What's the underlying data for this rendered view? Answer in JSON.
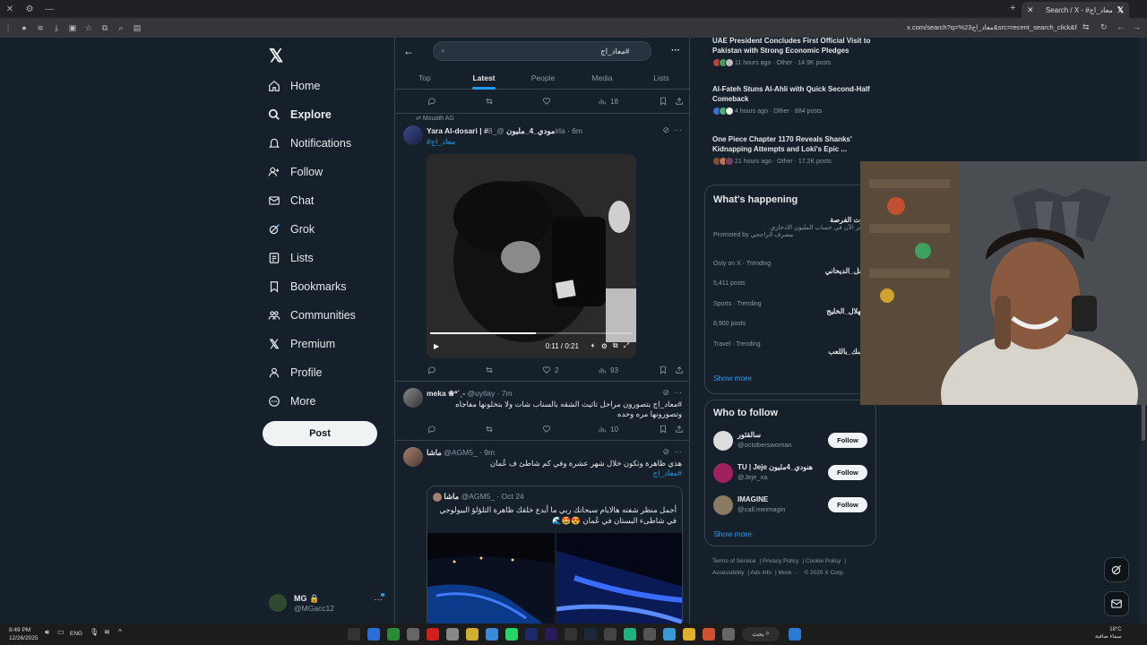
{
  "browser": {
    "tab_title": "Search / X - #معاد_اج",
    "url": "x.com/search?q=%23معاد_اج&src=recent_search_click&f=live"
  },
  "nav": {
    "items": [
      {
        "label": "Home",
        "icon": "home-icon"
      },
      {
        "label": "Explore",
        "icon": "search-icon"
      },
      {
        "label": "Notifications",
        "icon": "bell-icon"
      },
      {
        "label": "Follow",
        "icon": "follow-icon"
      },
      {
        "label": "Chat",
        "icon": "mail-icon"
      },
      {
        "label": "Grok",
        "icon": "grok-icon"
      },
      {
        "label": "Lists",
        "icon": "lists-icon"
      },
      {
        "label": "Bookmarks",
        "icon": "bookmark-icon"
      },
      {
        "label": "Communities",
        "icon": "communities-icon"
      },
      {
        "label": "Premium",
        "icon": "x-logo-icon"
      },
      {
        "label": "Profile",
        "icon": "profile-icon"
      },
      {
        "label": "More",
        "icon": "more-icon"
      }
    ],
    "post_label": "Post"
  },
  "account": {
    "name": "MG 🔒",
    "handle": "@MGacc12"
  },
  "search": {
    "value": "#معاد_اج"
  },
  "tabs": [
    "Top",
    "Latest",
    "People",
    "Media",
    "Lists"
  ],
  "tweets": {
    "first_actions": {
      "views": "18"
    },
    "t1": {
      "repost_label": "Mouath AG",
      "name": "Yara Al-dosari | #مودي_4_مليون",
      "handle": "@_8irla · 6m",
      "text": "#معاد_اج",
      "video_time": "0:11 / 0:21",
      "video_progress": 0.52,
      "likes": "2",
      "views": "93"
    },
    "t2": {
      "name": "meka ❀*ˊˎ-",
      "handle": "@uytlay · 7m",
      "text": "#معاد_اج بتصورون مراحل تاثيث الشقه بالسناب شات ولا بتخلونها مفاجاه وتصورونها مره وحده",
      "views": "10"
    },
    "t3": {
      "name": "ماشا",
      "handle": "@AGM5_ · 9m",
      "text": "هذي ظاهرة وتكون خلال شهر عشرة وفي كم شاطئ ف عُمان",
      "hashtag": "#معاد_اج",
      "quote": {
        "name": "ماشا",
        "handle": "@AGM5_ · Oct 24",
        "text": "أجمل منظر شفته هالايام سبحانك ربي ما أبدع خلقك ظاهرة التلؤلؤ البيولوجي في شاطىء البستان في عُمان 😍🤩🌊"
      }
    }
  },
  "news": [
    {
      "title": "UAE President Concludes First Official Visit to Pakistan with Strong Economic Pledges",
      "meta": "11 hours ago · Other · 14.9K posts"
    },
    {
      "title": "Al-Fateh Stuns Al-Ahli with Quick Second-Half Comeback",
      "meta": "4 hours ago · Other · 884 posts"
    },
    {
      "title": "One Piece Chapter 1170 Reveals Shanks' Kidnapping Attempts and Loki's Epic ...",
      "meta": "21 hours ago · Other · 17.2K posts"
    }
  ],
  "whats_happening": {
    "title": "What's happening",
    "promo": {
      "tag": "فوّت الفرصة",
      "desc": "ادخر الآن في حساب المليون الادخاري",
      "promoted": "Promoted by مصرف الراجحي"
    },
    "trends": [
      {
        "category": "Only on X · Trending",
        "tag": "#عل_الديحاني",
        "posts": "5,411 posts"
      },
      {
        "category": "Sports · Trending",
        "tag": "#لهلال_الخليج",
        "posts": "8,900 posts"
      },
      {
        "category": "Travel · Trending",
        "tag": "#سك_باللعب",
        "posts": ""
      }
    ],
    "show_more": "Show more"
  },
  "who_to_follow": {
    "title": "Who to follow",
    "users": [
      {
        "name": "سالقثور",
        "handle": "@octoberswoman",
        "button": "Follow"
      },
      {
        "name": "TU | Jeje هنودي_4مليون",
        "handle": "@Jeje_xa",
        "button": "Follow"
      },
      {
        "name": "IMAGINE",
        "handle": "@call.meimagin",
        "button": "Follow"
      }
    ],
    "show_more": "Show more"
  },
  "footer": [
    "Terms of Service",
    "Privacy Policy",
    "Cookie Policy",
    "Accessibility",
    "Ads info",
    "More ···",
    "© 2025 X Corp."
  ],
  "taskbar": {
    "time": "8:49 PM",
    "date": "12/26/2025",
    "lang": "ENG",
    "search": "بحث",
    "weather_temp": "18°C",
    "weather_desc": "سماء صافية"
  },
  "colors": {
    "accent": "#1d9bf0",
    "background": "#15202b",
    "border": "#38444d"
  }
}
